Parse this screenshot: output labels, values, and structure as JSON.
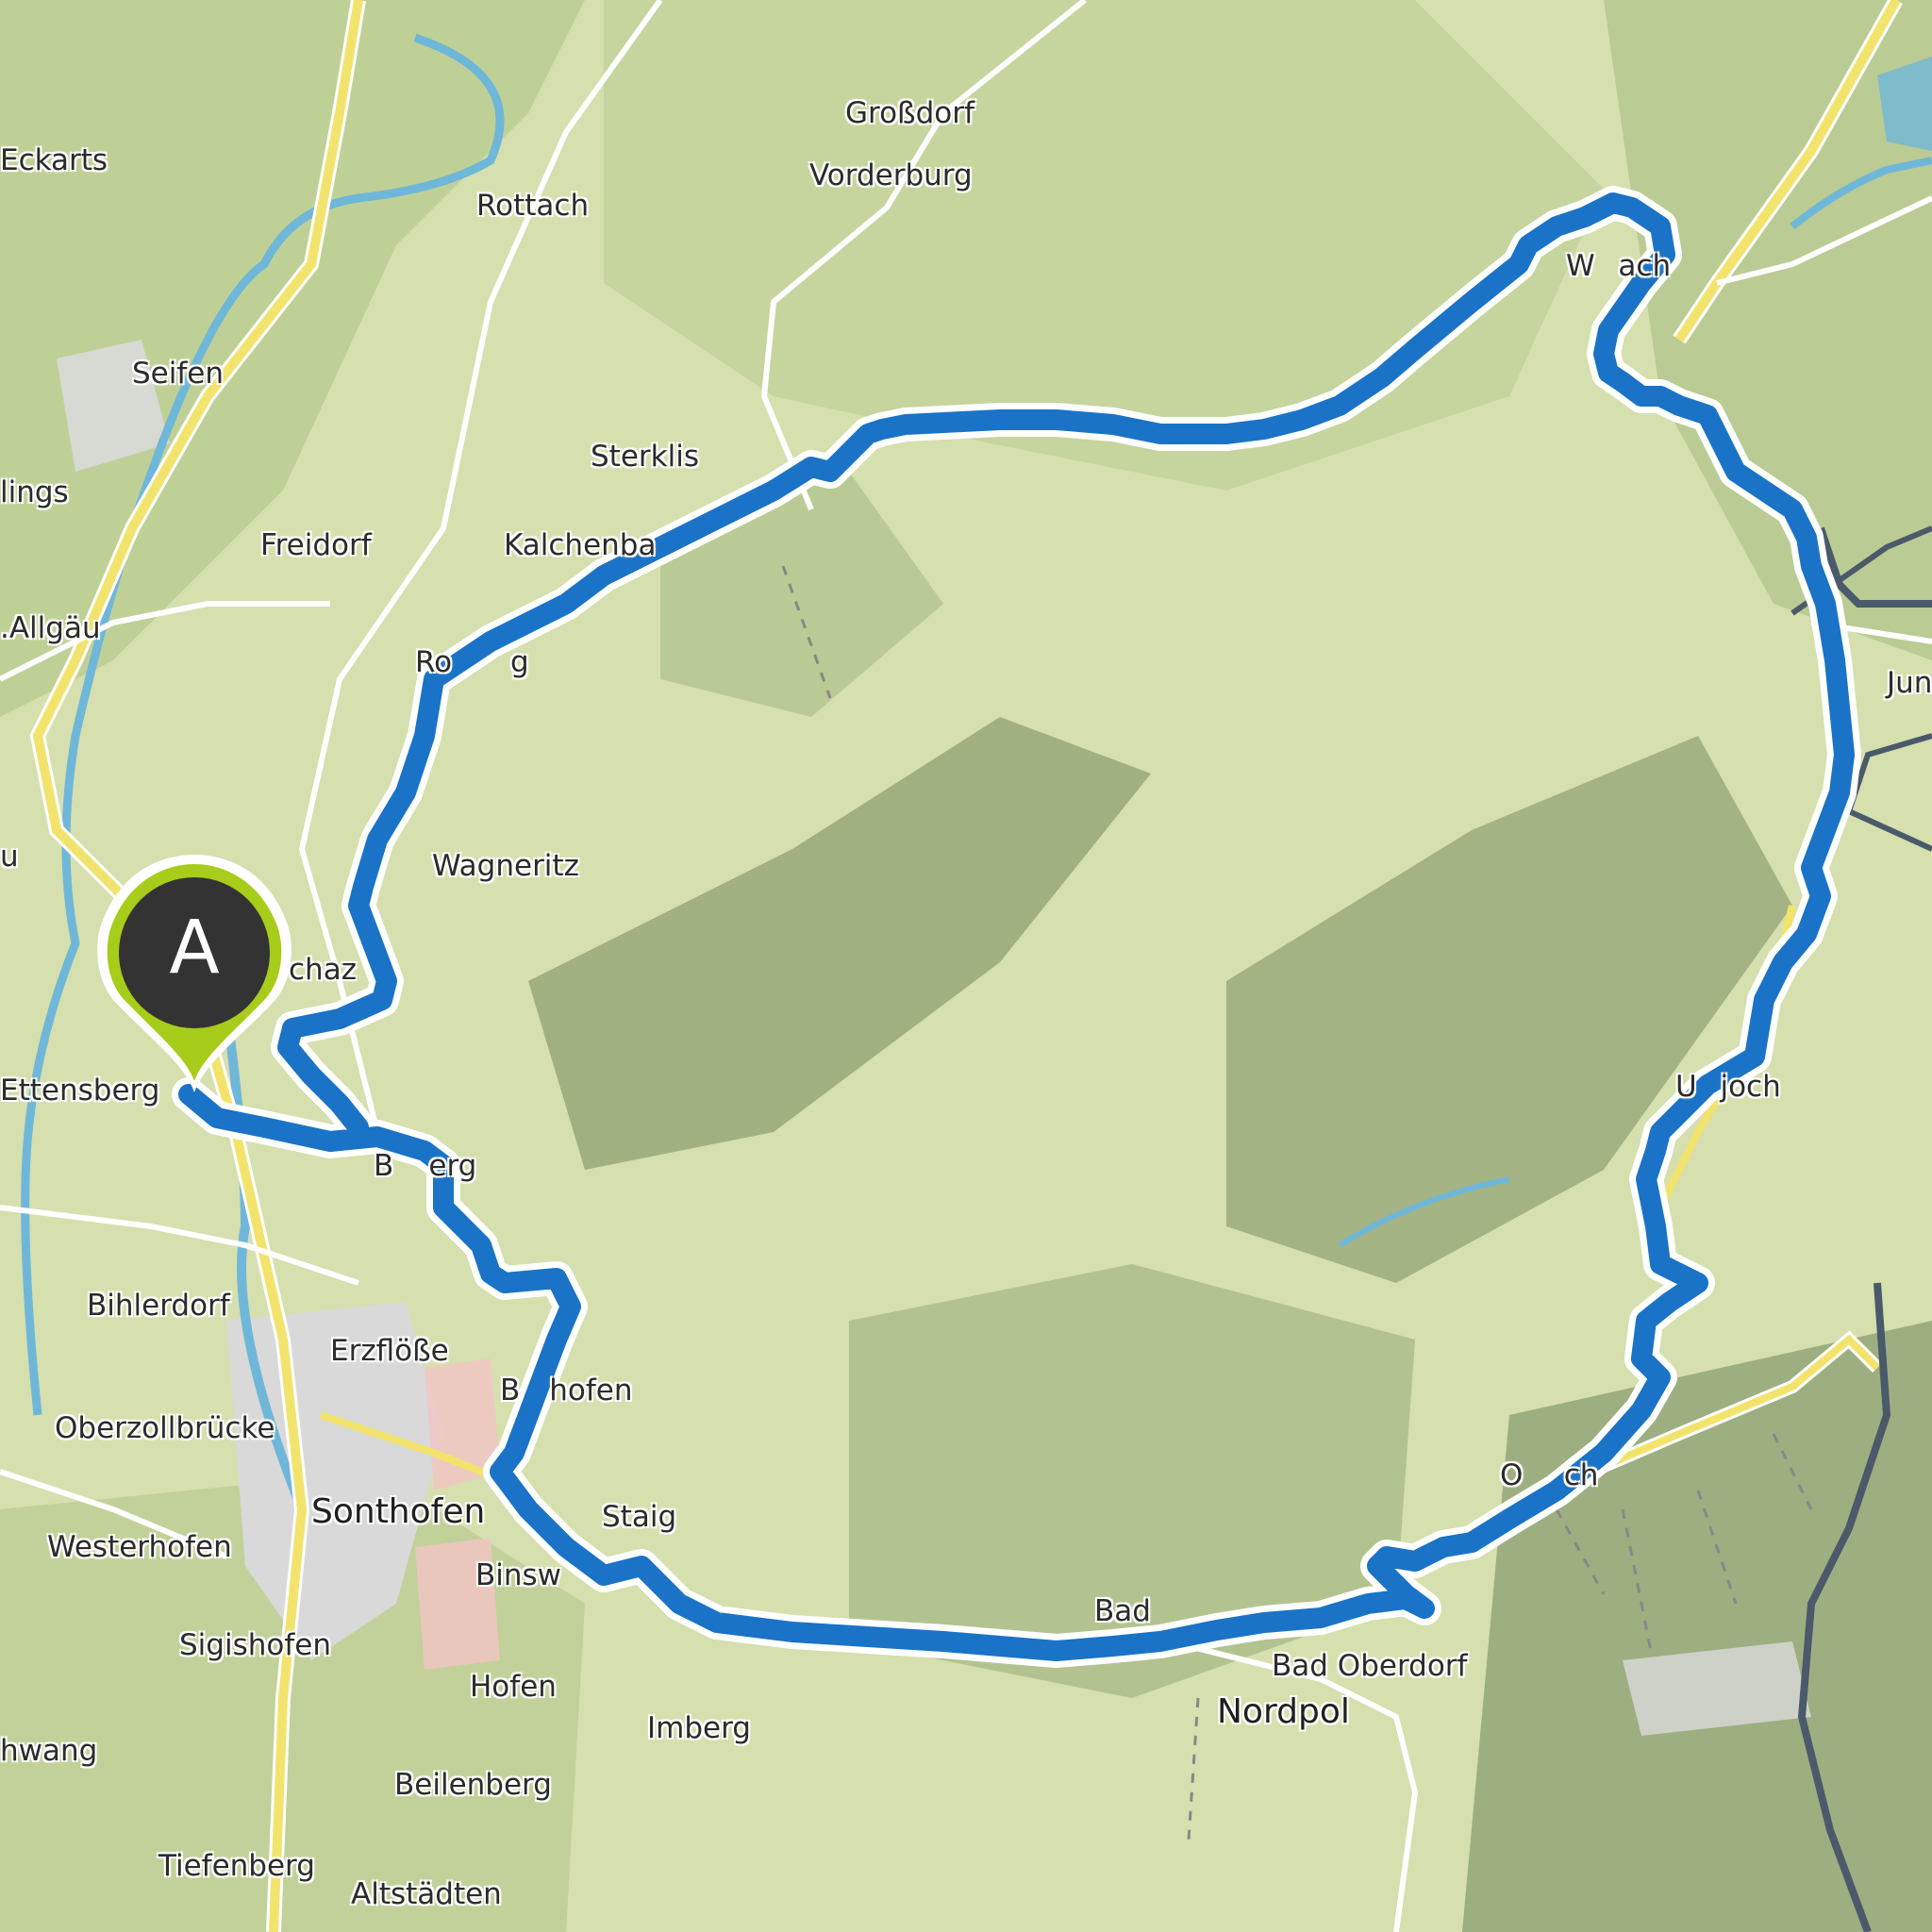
{
  "map": {
    "colors": {
      "land": "#d6dfae",
      "forest": "#a9bf85",
      "route": "#1a73c6",
      "route_outline": "#ffffff",
      "river": "#6fb7d8",
      "main_road": "#f2e36d",
      "border": "#4a5a6a",
      "settlement": "#d9d9d9",
      "marker_green": "#a8cc1a",
      "marker_dark": "#333333"
    },
    "start_marker": {
      "label": "A",
      "icon": "map-pin-icon"
    },
    "places": {
      "grossdorf": "Großdorf",
      "vorderburg": "Vorderburg",
      "eckarts": "Eckarts",
      "rottach": "Rottach",
      "wertach": "W    ach",
      "seifen": "Seifen",
      "sterklis": "Sterklis",
      "lings": "lings",
      "freidorf": "Freidorf",
      "kalchenbach": "Kalchenba",
      "allgau": ".Allgäu",
      "rossberg": "Ro          g",
      "jungholz": "Jun",
      "u": "u",
      "wagneritz": "Wagneritz",
      "schazwang": "chaz",
      "ettensberg": "Ettensberg",
      "unterjoch": "U    joch",
      "berg": "B      erg",
      "bihlerdorf": "Bihlerdorf",
      "erzfloesse": "Erzflöße",
      "burghofen": "B     hofen",
      "oberzollbruecke": "Oberzollbrücke",
      "sonthofen": "Sonthofen",
      "staig": "Staig",
      "oberjoch": "O       ch",
      "westerhofen": "Westerhofen",
      "binswangen": "Binsw",
      "bad_hindelang": "Bad",
      "sigishofen": "Sigishofen",
      "hofen": "Hofen",
      "bad_oberdorf": "Bad Oberdorf",
      "nordpol": "Nordpol",
      "imberg": "Imberg",
      "schwang": "hwang",
      "beilenberg": "Beilenberg",
      "tiefenberg": "Tiefenberg",
      "altstaedten": "Altstädten"
    }
  }
}
